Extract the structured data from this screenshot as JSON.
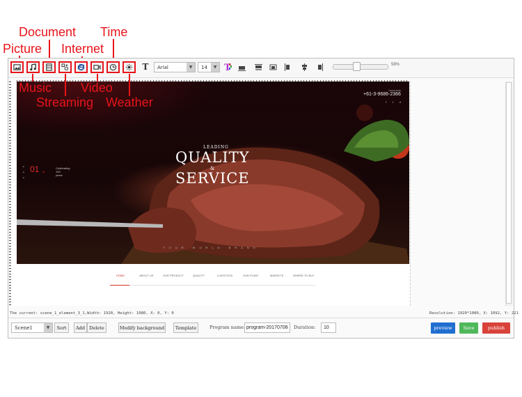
{
  "callouts": {
    "document": "Document",
    "time": "Time",
    "picture": "Picture",
    "internet": "Internet",
    "music": "Music",
    "video": "Video",
    "streaming": "Streaming",
    "weather": "Weather"
  },
  "toolbar": {
    "font": "Arial",
    "font_size": "14",
    "text_tool": "T",
    "zoom": "58%",
    "zoom_fraction": 0.2
  },
  "canvas": {
    "leading": "LEADING",
    "headline1": "QUALITY",
    "amp": "&",
    "headline2": "SERVICE",
    "phone_label": "TELEPHONE",
    "phone": "+61-3-9686-2366",
    "social": [
      "f",
      "t",
      "é"
    ],
    "years_number": "01",
    "years_unit": "st",
    "years_text1": "Celebrating",
    "years_text2": "100",
    "years_text3": "years",
    "tagline": "YOUR WORLD BRAND",
    "nav": [
      "HOME",
      "ABOUT US",
      "OUR PRODUCT",
      "QUALITY",
      "LIVESTOCK",
      "OUR PLANT",
      "MARKETS",
      "WHERE TO BUY"
    ]
  },
  "status": {
    "current": "The current: scene_1_element_3_1,Width: 1920, Height: 1080, X: 0, Y: 0",
    "resolution": "Resolution: 1920*1080, X: 1092, Y: 221"
  },
  "bottom": {
    "scene": "Scene1",
    "sort": "Sort",
    "add": "Add",
    "delete": "Delete",
    "modify_bg": "Modify background",
    "template": "Template",
    "program_label": "Program name:",
    "program_value": "program-201707060",
    "duration_label": "Duration:",
    "duration_value": "10",
    "preview": "preview",
    "save": "Save",
    "publish": "publish"
  },
  "colors": {
    "callout": "#e8141a",
    "preview": "#1f6ed0",
    "save": "#4fb85a",
    "publish": "#d9423a"
  }
}
